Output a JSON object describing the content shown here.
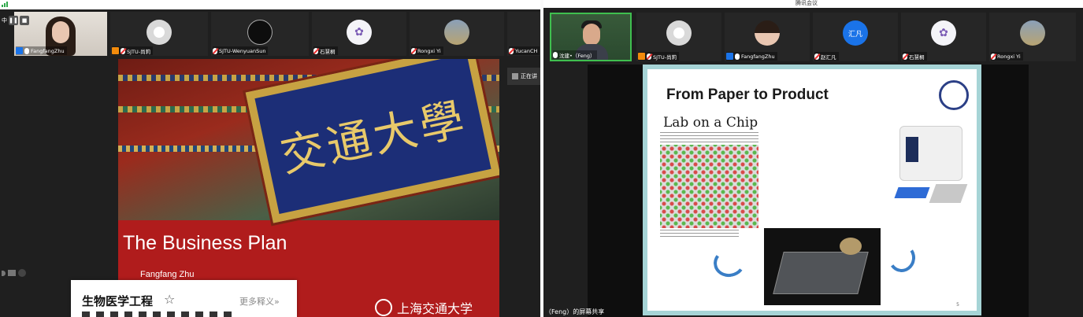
{
  "left": {
    "toolbar_status": "中",
    "participants": [
      {
        "name": "FangfangZhu",
        "type": "video-female",
        "badge": "host"
      },
      {
        "name": "SJTU-尚莉",
        "type": "avatar",
        "badge": "orange"
      },
      {
        "name": "SJTU-WenyuanSun",
        "type": "avatar-dark",
        "badge": "none"
      },
      {
        "name": "石慧桐",
        "type": "avatar-cartoon",
        "badge": "none"
      },
      {
        "name": "Rongxi Yi",
        "type": "avatar-photo",
        "badge": "none"
      },
      {
        "name": "YucanCH",
        "type": "avatar",
        "badge": "none"
      }
    ],
    "sharing_label": "正在讲",
    "slide": {
      "plaque_text": "交通大學",
      "title": "The Business Plan",
      "author": "Fangfang Zhu",
      "logo_text": "上海交通大学"
    },
    "dictionary": {
      "term": "生物医学工程",
      "star": "☆",
      "more": "更多释义»"
    }
  },
  "right": {
    "window_title": "腾讯会议",
    "participants": [
      {
        "name": "沈建•（Feng）",
        "type": "video-male",
        "badge": "none"
      },
      {
        "name": "SJTU-尚莉",
        "type": "avatar",
        "badge": "orange"
      },
      {
        "name": "FangfangZhu",
        "type": "avatar-photo",
        "badge": "host"
      },
      {
        "name": "赵汇凡",
        "type": "avatar-text",
        "badge": "none",
        "avatar_text": "汇凡"
      },
      {
        "name": "石慧桐",
        "type": "avatar-cartoon",
        "badge": "none"
      },
      {
        "name": "Rongxi Yi",
        "type": "avatar-photo",
        "badge": "none"
      }
    ],
    "slide": {
      "title": "From Paper to Product",
      "subtitle": "Lab on a Chip",
      "page": "5"
    },
    "share_footer": "（Feng）的屏幕共享"
  },
  "colors": {
    "slide_red": "#b01c1c",
    "slide_teal_border": "#a6d4d6",
    "accent_blue": "#1a73e8"
  }
}
